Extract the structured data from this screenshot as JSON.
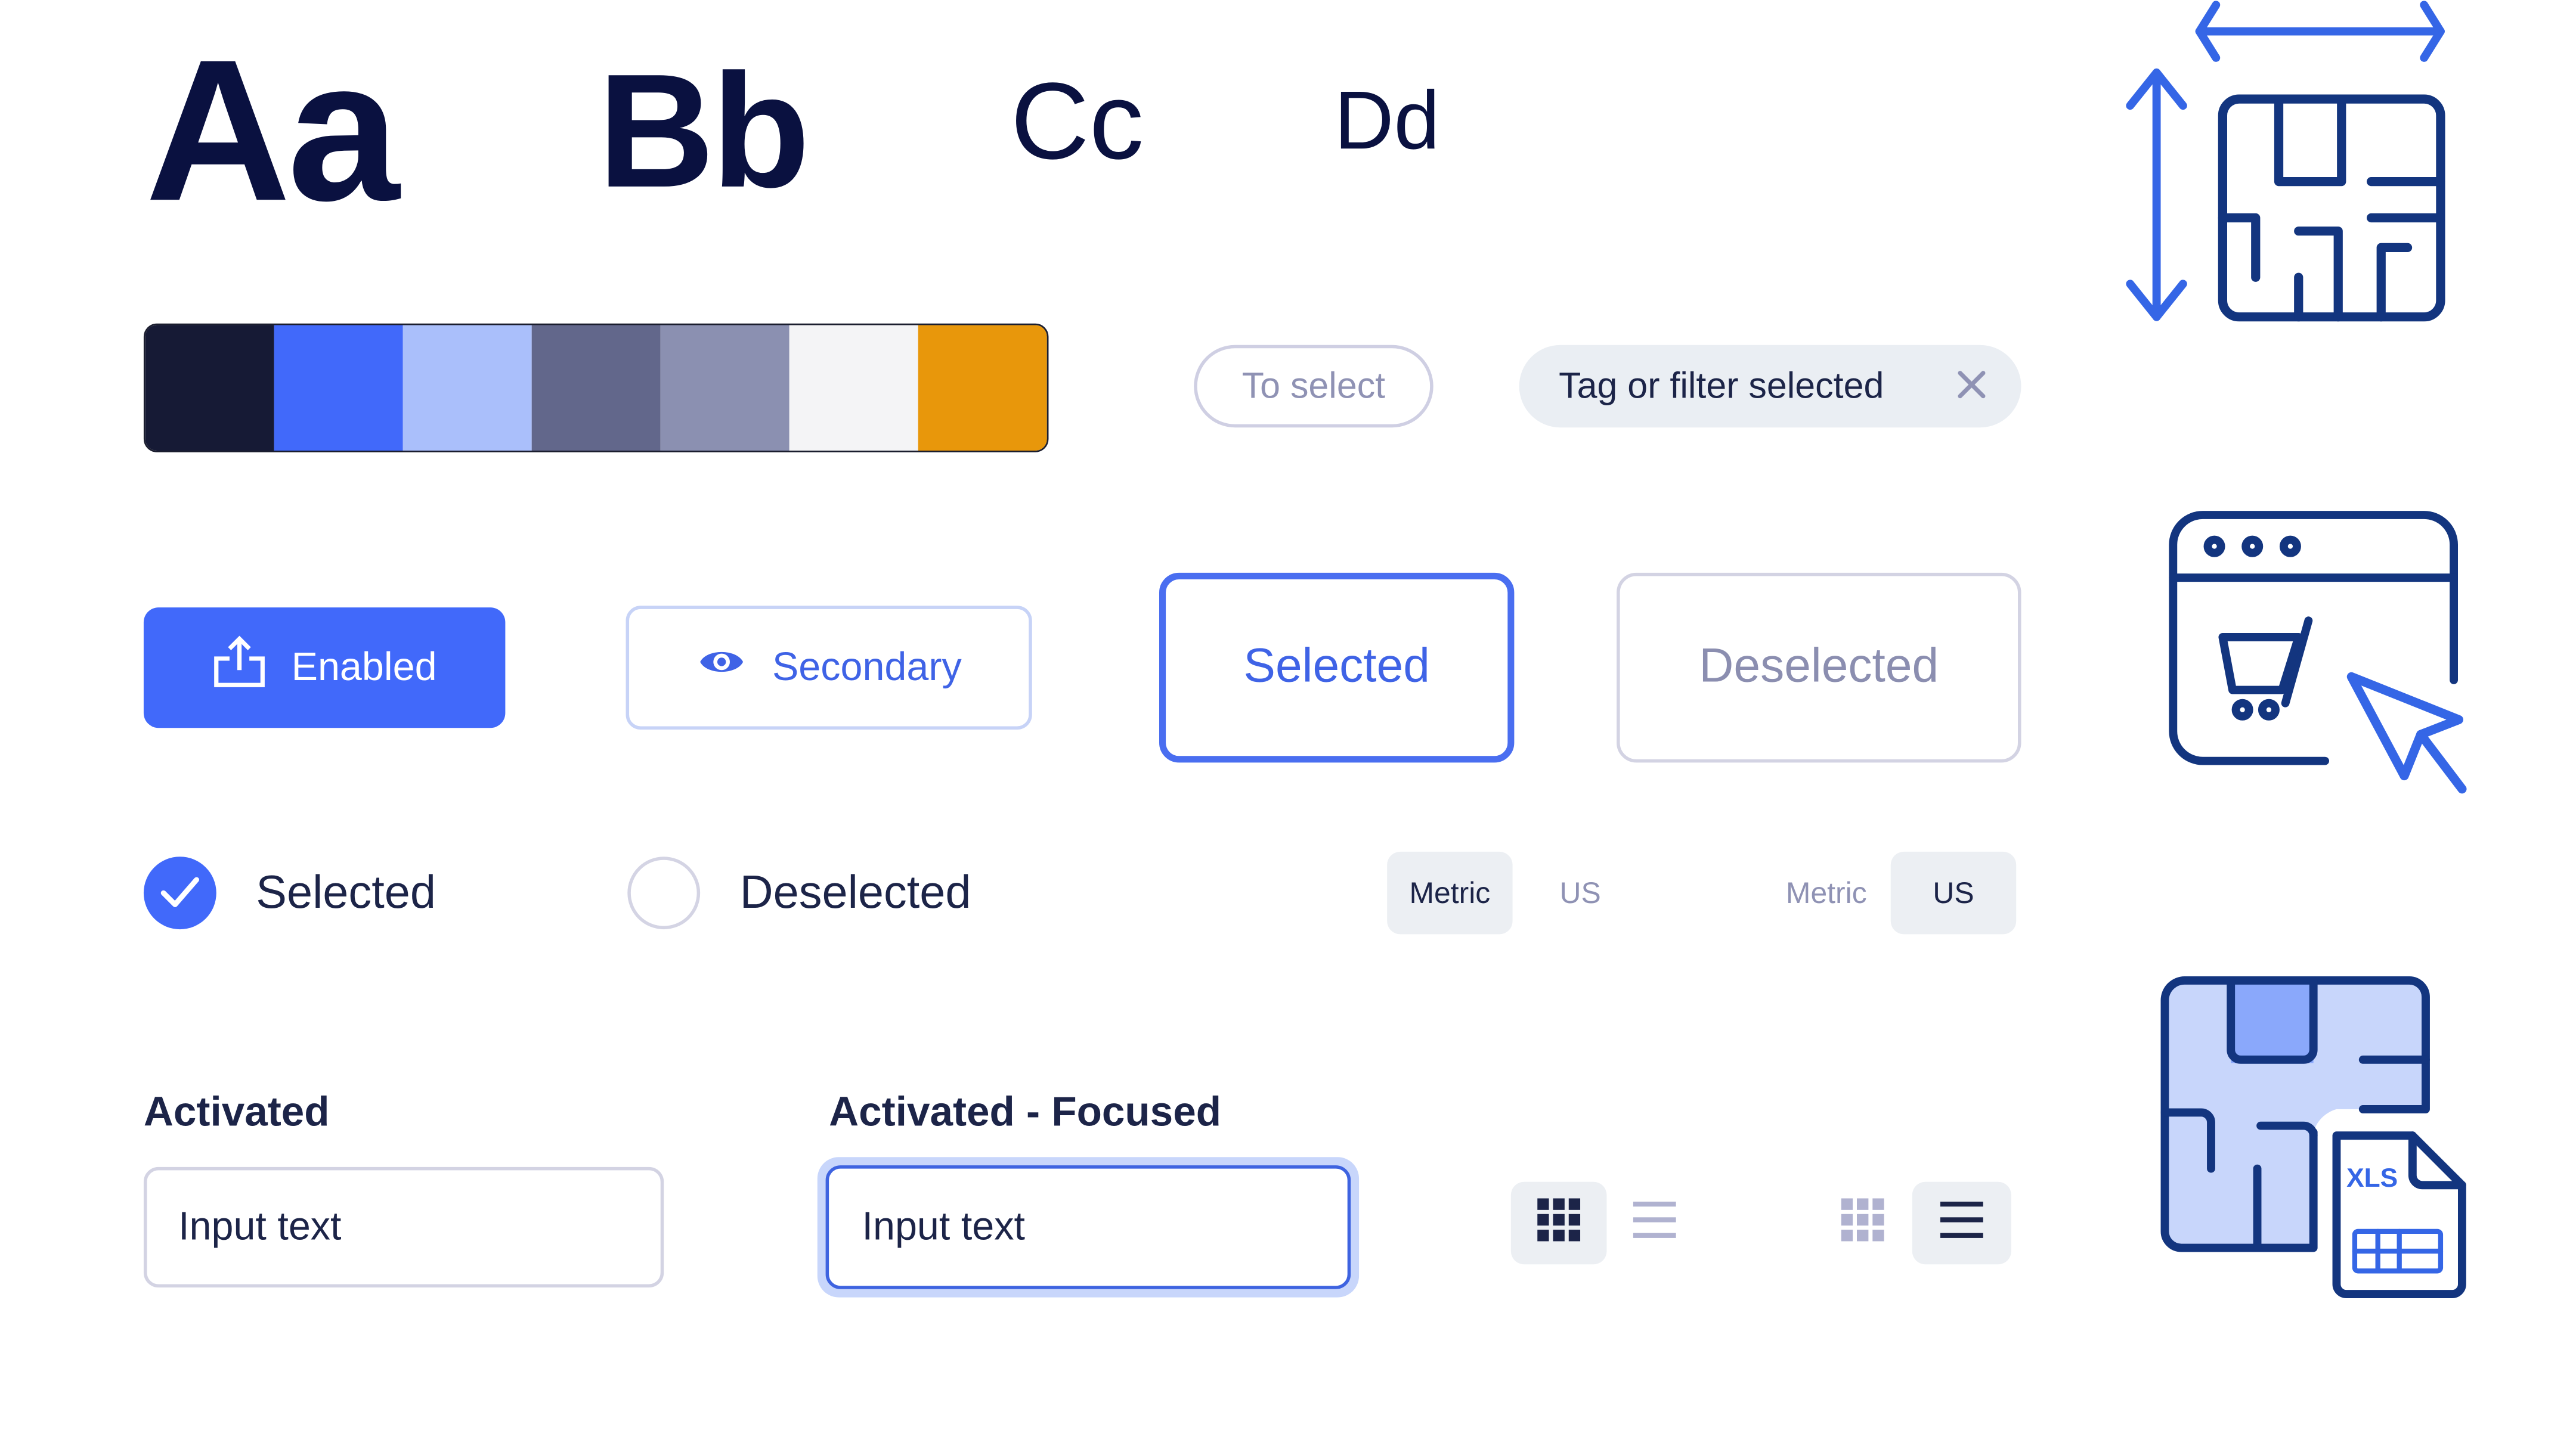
{
  "typography": {
    "samples": [
      "Aa",
      "Bb",
      "Cc",
      "Dd"
    ]
  },
  "palette": {
    "colors": [
      "#161a35",
      "#4169fa",
      "#aabffb",
      "#62678b",
      "#8b90b1",
      "#f4f4f6",
      "#e8970b"
    ]
  },
  "chips": {
    "to_select": "To select",
    "tag_selected": "Tag or filter selected",
    "tag_remove_icon": "close-icon"
  },
  "buttons": {
    "primary": {
      "label": "Enabled",
      "icon": "upload-icon"
    },
    "secondary": {
      "label": "Secondary",
      "icon": "eye-icon"
    },
    "selected": {
      "label": "Selected"
    },
    "deselected": {
      "label": "Deselected"
    }
  },
  "radios": {
    "selected": {
      "label": "Selected",
      "checked": true
    },
    "deselected": {
      "label": "Deselected",
      "checked": false
    }
  },
  "unit_toggles": [
    {
      "options": [
        "Metric",
        "US"
      ],
      "active": "Metric"
    },
    {
      "options": [
        "Metric",
        "US"
      ],
      "active": "US"
    }
  ],
  "inputs": {
    "activated": {
      "label": "Activated",
      "value": "Input text"
    },
    "focused": {
      "label": "Activated - Focused",
      "value": "Input text"
    }
  },
  "view_toggles": [
    {
      "options": [
        "grid",
        "list"
      ],
      "active": "grid"
    },
    {
      "options": [
        "grid",
        "list"
      ],
      "active": "list"
    }
  ],
  "illustrations": {
    "floorplan_dimensions": "floorplan-dimensions-icon",
    "browser_cart": "browser-cart-cursor-icon",
    "floorplan_xls": "floorplan-xls-icon",
    "xls_label": "XLS"
  },
  "colors": {
    "primary": "#4169fa",
    "navy": "#13357f",
    "text": "#1c2448",
    "muted": "#8f92b4",
    "chip_bg": "#eaeef3",
    "focus_ring": "#c8d6fb"
  }
}
